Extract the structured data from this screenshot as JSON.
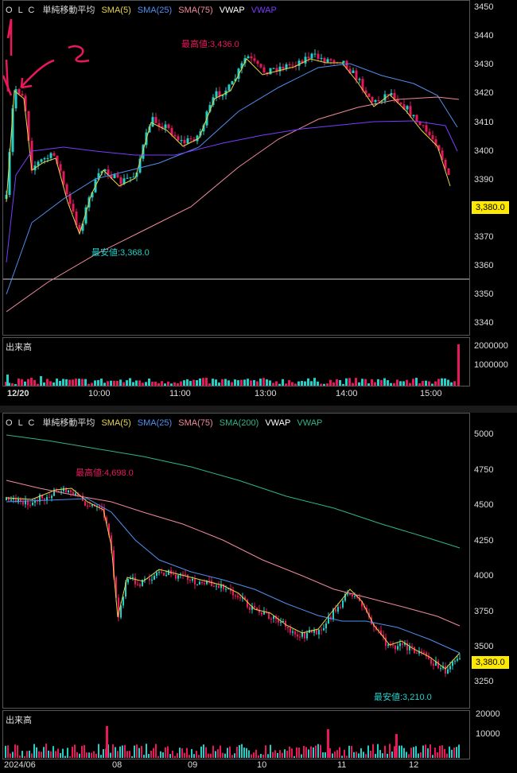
{
  "top_chart": {
    "legend": {
      "symbol": "O L C",
      "title": "単純移動平均",
      "items": [
        {
          "label": "SMA(5)",
          "color": "#e8d44a"
        },
        {
          "label": "SMA(25)",
          "color": "#4f8ff0"
        },
        {
          "label": "SMA(75)",
          "color": "#f08a9a"
        },
        {
          "label": "VWAP",
          "color": "#ffffff"
        },
        {
          "label": "VWAP",
          "color": "#7a3cff"
        }
      ]
    },
    "y_ticks": [
      "3450",
      "3440",
      "3430",
      "3420",
      "3410",
      "3400",
      "3390",
      "3370",
      "3360",
      "3350",
      "3340"
    ],
    "current_price": "3,380.0",
    "high_annotation": "最高値:3,436.0",
    "low_annotation": "最安値:3,368.0",
    "volume_title": "出来高",
    "volume_ticks": [
      "2000000",
      "1000000"
    ],
    "x_ticks": [
      "12/20",
      "10:00",
      "11:00",
      "13:00",
      "14:00",
      "15:00"
    ],
    "handwritten_marks": [
      "1",
      "2"
    ]
  },
  "bottom_chart": {
    "legend": {
      "symbol": "O L C",
      "title": "単純移動平均",
      "items": [
        {
          "label": "SMA(5)",
          "color": "#e8d44a"
        },
        {
          "label": "SMA(25)",
          "color": "#4f8ff0"
        },
        {
          "label": "SMA(75)",
          "color": "#f08a9a"
        },
        {
          "label": "SMA(200)",
          "color": "#2fb58a"
        },
        {
          "label": "VWAP",
          "color": "#ffffff"
        },
        {
          "label": "VWAP",
          "color": "#2fb58a"
        }
      ]
    },
    "y_ticks": [
      "5000",
      "4750",
      "4500",
      "4250",
      "4000",
      "3750",
      "3500",
      "3250"
    ],
    "current_price": "3,380.0",
    "high_annotation": "最高値:4,698.0",
    "low_annotation": "最安値:3,210.0",
    "volume_title": "出来高",
    "volume_ticks": [
      "20000",
      "10000"
    ],
    "x_ticks": [
      "2024/06",
      "08",
      "09",
      "10",
      "11",
      "12"
    ]
  },
  "colors": {
    "up": "#22d0c8",
    "down": "#e8185a",
    "badge": "#ffe800"
  }
}
